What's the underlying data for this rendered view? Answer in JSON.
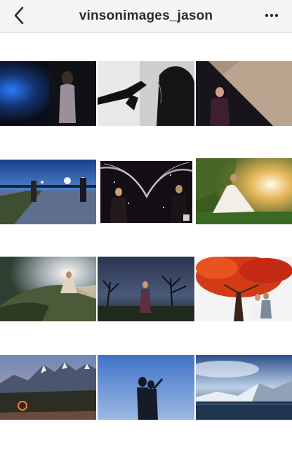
{
  "header": {
    "title": "vinsonimages_jason",
    "back_icon": "chevron-left-icon",
    "more_icon": "more-horizontal-icon"
  },
  "grid": {
    "rows": [
      [
        "blue-lit-portrait",
        "silhouette-hands",
        "man-diagonal-shadow"
      ],
      [
        "couple-road-dusk",
        "couple-sparkler-arc",
        "bride-sunset-field"
      ],
      [
        "runner-hillside-flare",
        "woman-dark-trees",
        "couple-red-tree"
      ],
      [
        "mountain-range-light",
        "couple-silhouette-blue",
        "glacier-lake"
      ]
    ]
  }
}
